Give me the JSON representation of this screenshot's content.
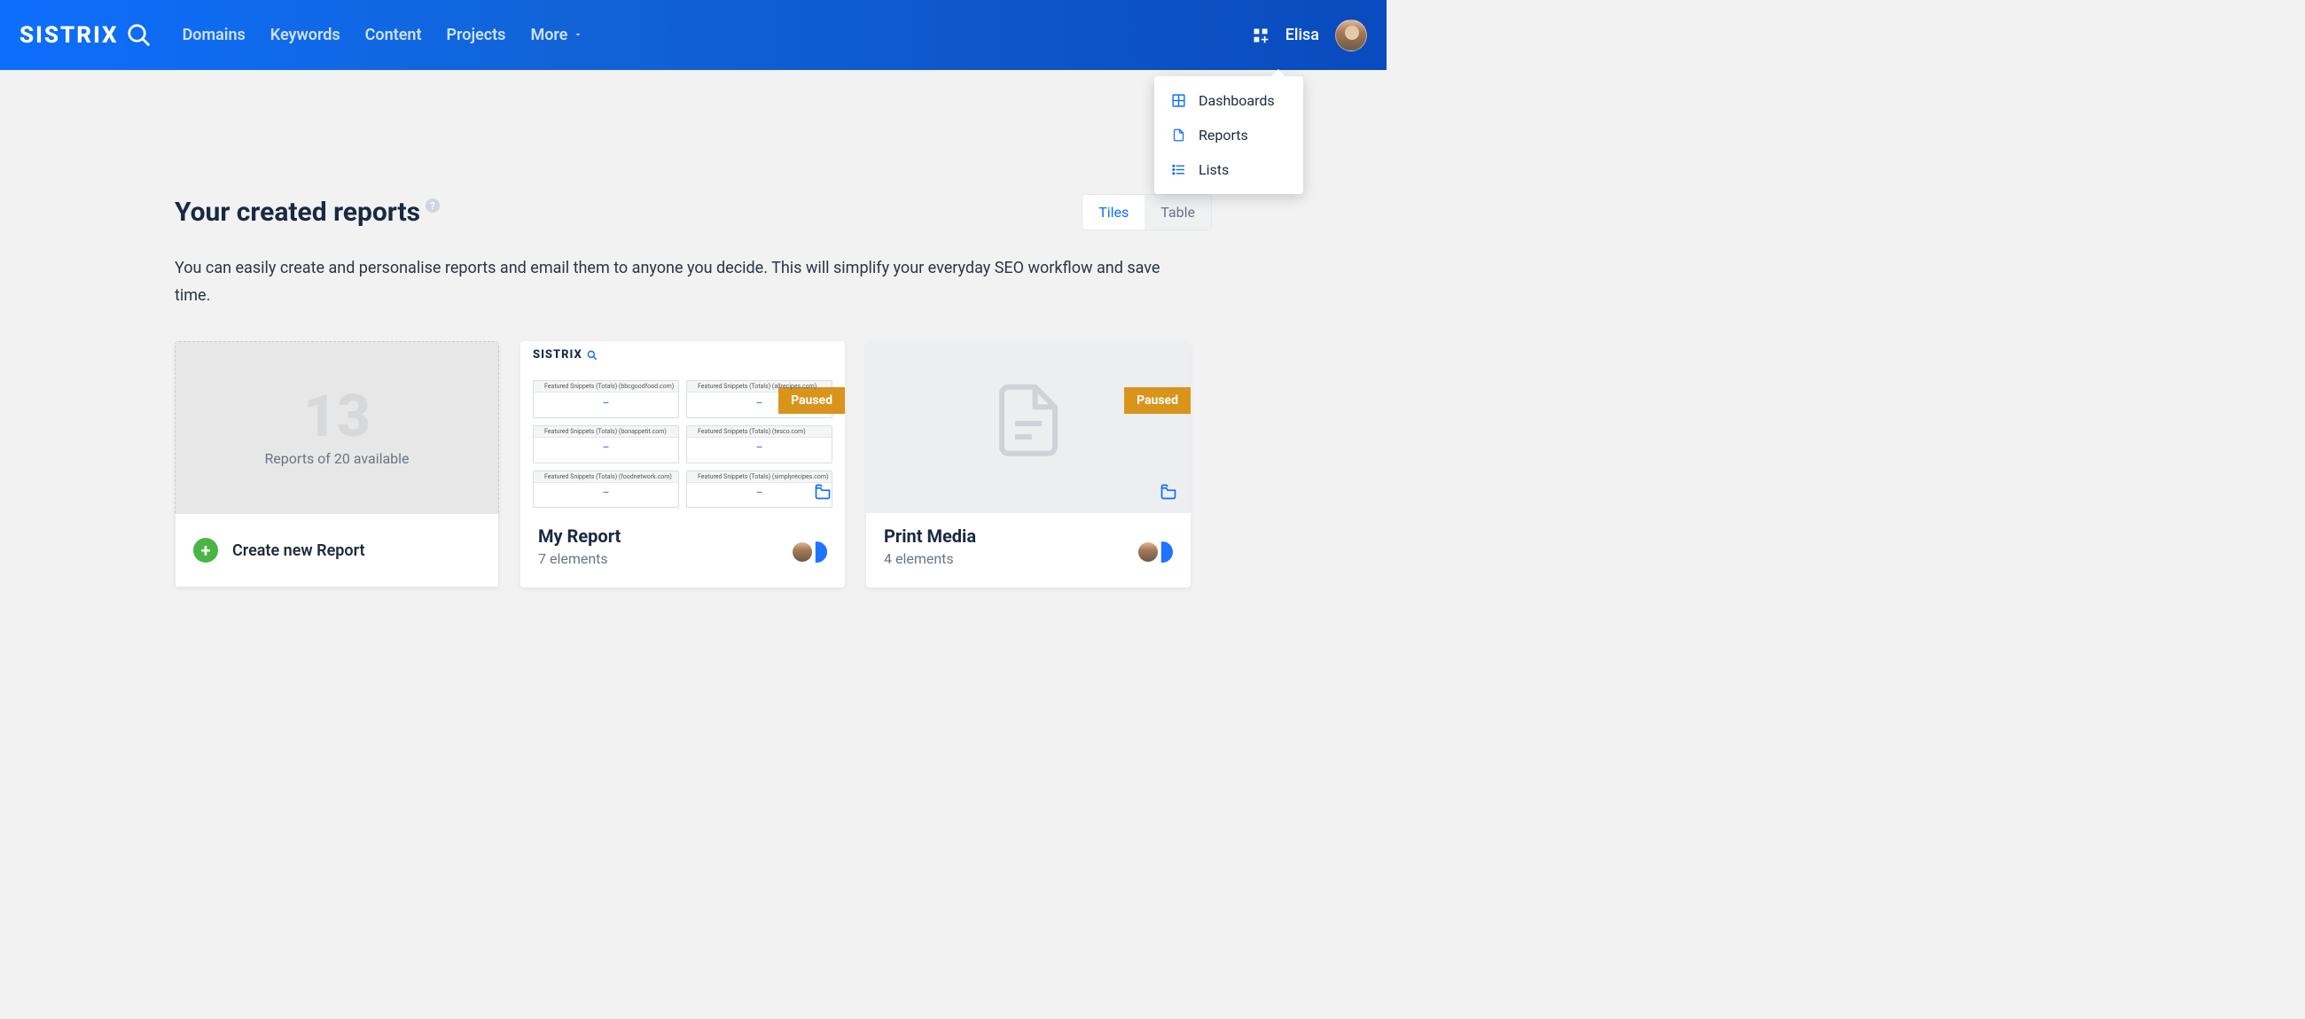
{
  "header": {
    "logo_text": "SISTRIX",
    "nav": [
      "Domains",
      "Keywords",
      "Content",
      "Projects",
      "More"
    ],
    "user_name": "Elisa"
  },
  "dropdown": {
    "items": [
      {
        "label": "Dashboards",
        "icon": "grid"
      },
      {
        "label": "Reports",
        "icon": "file"
      },
      {
        "label": "Lists",
        "icon": "list"
      }
    ]
  },
  "page": {
    "title": "Your created reports",
    "description": "You can easily create and personalise reports and email them to anyone you decide. This will simplify your everyday SEO workflow and save time."
  },
  "view_toggle": {
    "tiles": "Tiles",
    "table": "Table"
  },
  "create_card": {
    "count": "13",
    "subtitle": "Reports of 20 available",
    "button_label": "Create new Report"
  },
  "reports": [
    {
      "title": "My Report",
      "elements_label": "7 elements",
      "badge": "Paused",
      "preview_type": "snippets",
      "snippets": [
        "Featured Snippets (Totals) (bbcgoodfood.com)",
        "Featured Snippets (Totals) (allrecipes.com)",
        "Featured Snippets (Totals) (bonappetit.com)",
        "Featured Snippets (Totals) (tesco.com)",
        "Featured Snippets (Totals) (foodnetwork.com)",
        "Featured Snippets (Totals) (simplyrecipes.com)"
      ]
    },
    {
      "title": "Print Media",
      "elements_label": "4 elements",
      "badge": "Paused",
      "preview_type": "blank"
    }
  ]
}
